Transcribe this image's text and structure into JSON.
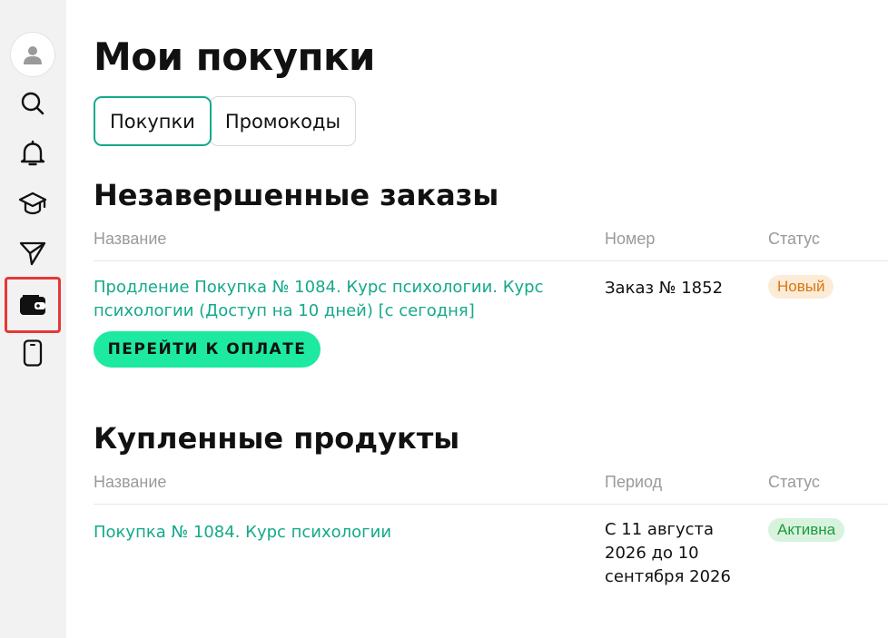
{
  "sidebar": {
    "items": [
      {
        "name": "profile",
        "icon": "user-icon"
      },
      {
        "name": "search",
        "icon": "search-icon"
      },
      {
        "name": "notifications",
        "icon": "bell-icon"
      },
      {
        "name": "courses",
        "icon": "graduation-cap-icon"
      },
      {
        "name": "messages",
        "icon": "paper-plane-icon"
      },
      {
        "name": "purchases",
        "icon": "wallet-icon",
        "active": true
      },
      {
        "name": "mobile-app",
        "icon": "smartphone-icon"
      }
    ],
    "active_outline_color": "#e53935"
  },
  "page": {
    "title": "Мои покупки"
  },
  "tabs": [
    {
      "label": "Покупки",
      "active": true
    },
    {
      "label": "Промокоды",
      "active": false
    }
  ],
  "pending": {
    "title": "Незавершенные заказы",
    "columns": {
      "name": "Название",
      "number": "Номер",
      "status": "Статус"
    },
    "rows": [
      {
        "name": "Продление Покупка № 1084. Курс психологии. Курс психологии (Доступ на 10 дней) [с сегодня]",
        "number": "Заказ № 1852",
        "status": "Новый",
        "action": "ПЕРЕЙТИ К ОПЛАТЕ"
      }
    ]
  },
  "purchased": {
    "title": "Купленные продукты",
    "columns": {
      "name": "Название",
      "period": "Период",
      "status": "Статус"
    },
    "rows": [
      {
        "name": "Покупка № 1084. Курс психологии",
        "period": "С 11 августа 2026 до 10 сентября 2026",
        "status": "Активна"
      }
    ]
  },
  "colors": {
    "accent": "#14a98a",
    "button": "#1de9a0",
    "status_new": "#d9770f",
    "status_active": "#1f9a3a"
  }
}
